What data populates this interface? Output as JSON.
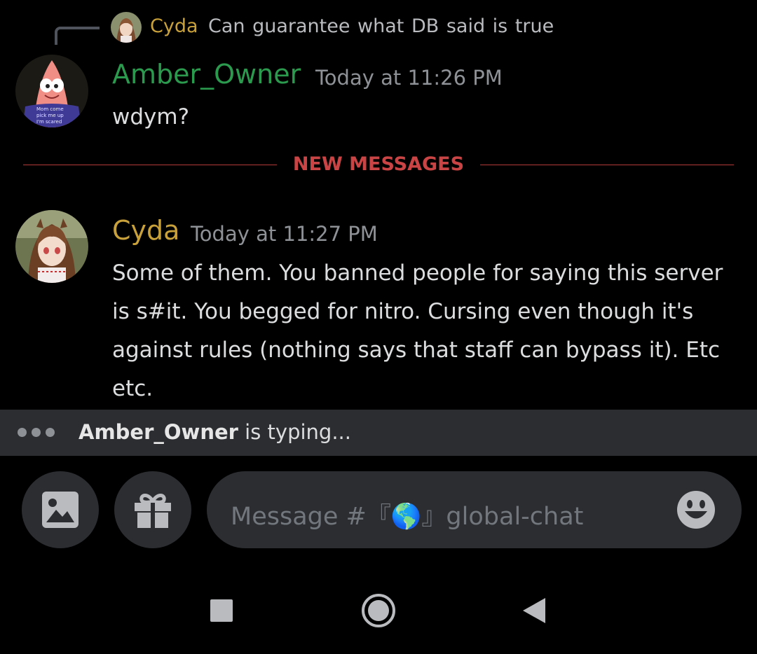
{
  "reply": {
    "author": "Cyda",
    "text": "Can  guarantee what DB said is true",
    "author_color": "#c9a13b"
  },
  "messages": [
    {
      "author": "Amber_Owner",
      "timestamp": "Today at 11:26 PM",
      "text": "wdym?",
      "author_color": "#2b9a4e",
      "avatar_caption": [
        "Mom come",
        "pick me up",
        "I'm scared"
      ]
    },
    {
      "author": "Cyda",
      "timestamp": "Today at 11:27 PM",
      "text": "Some of them. You banned people for saying this server is s#it. You begged for nitro. Cursing even though it's against rules (nothing says that staff can bypass it). Etc etc.",
      "author_color": "#c9a13b"
    }
  ],
  "divider": {
    "label": "NEW MESSAGES",
    "color": "#c94545"
  },
  "typing": {
    "name": "Amber_Owner",
    "suffix": "is typing..."
  },
  "composer": {
    "placeholder": "Message #『🌎』global-chat",
    "attach_icon": "image-icon",
    "gift_icon": "gift-icon",
    "emoji_icon": "emoji-icon"
  },
  "nav": {
    "recents_icon": "square-icon",
    "home_icon": "circle-icon",
    "back_icon": "triangle-back-icon"
  }
}
